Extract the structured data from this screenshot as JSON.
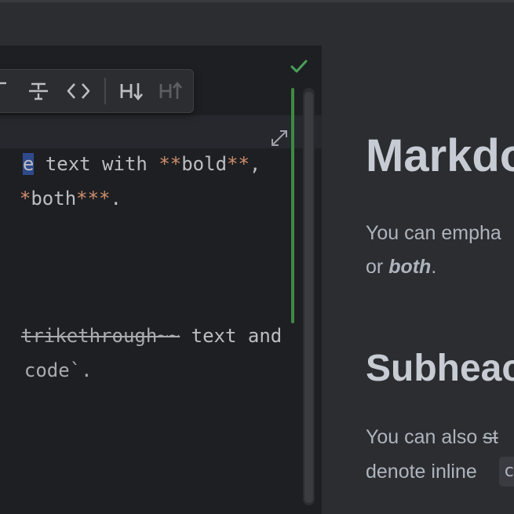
{
  "toolbar": {
    "buttons": [
      {
        "name": "italic",
        "label": ""
      },
      {
        "name": "strikethrough",
        "label": "∓"
      },
      {
        "name": "code",
        "label": "<>"
      },
      {
        "name": "heading-decrease",
        "label": "H↓"
      },
      {
        "name": "heading-increase",
        "label": "H↑"
      }
    ]
  },
  "editor": {
    "status": "inspection-ok",
    "line1": {
      "sel": "e",
      "a": " text with ",
      "m1": "**",
      "b": "bold",
      "m2": "**",
      "c": ","
    },
    "line2": {
      "m1": "*",
      "b": "both",
      "m2": "***",
      "c": "."
    },
    "line3": {
      "s": "trikethrough~~",
      "t": " text and"
    },
    "line4": {
      "t": "code`."
    }
  },
  "preview": {
    "h1": "Markdo",
    "p1_line1": "You can empha",
    "p1_line2_pre": "or ",
    "p1_line2_bold": "both",
    "p1_line2_post": ".",
    "h2": "Subheac",
    "p2_line1_pre": "You can also ",
    "p2_line1_strike": "st",
    "p2_line2": "denote inline",
    "p2_code": "c"
  },
  "colors": {
    "accent_green": "#3e8a43",
    "markup_orange": "#cf8e6d",
    "selection_blue": "#2e4a8c"
  }
}
